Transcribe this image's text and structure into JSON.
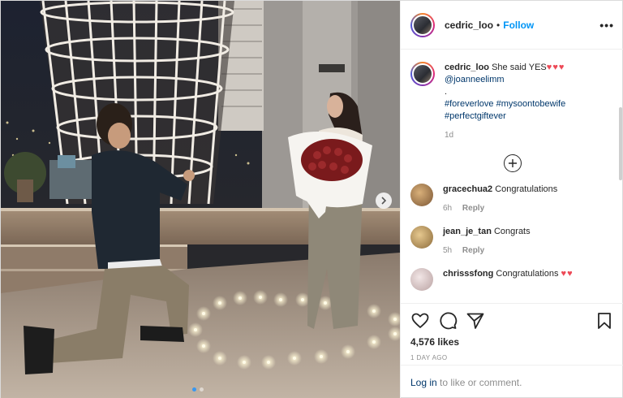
{
  "header": {
    "username": "cedric_loo",
    "separator": "•",
    "follow_label": "Follow",
    "more_label": "•••"
  },
  "caption": {
    "username": "cedric_loo",
    "text": "She said YES",
    "hearts": "♥♥♥",
    "mention": "@joanneelimm",
    "dot_line": ".",
    "hashtags_line1": "#foreverlove #mysoontobewife",
    "hashtags_line2": "#perfectgiftever",
    "time": "1d"
  },
  "load_more_icon": "plus-circle-icon",
  "comments": [
    {
      "username": "gracechua2",
      "text": "Congratulations",
      "hearts": "",
      "time": "6h",
      "reply": "Reply"
    },
    {
      "username": "jean_je_tan",
      "text": "Congrats",
      "hearts": "",
      "time": "5h",
      "reply": "Reply"
    },
    {
      "username": "chrisssfong",
      "text": "Congratulations",
      "hearts": "♥♥",
      "time": "",
      "reply": ""
    }
  ],
  "actions": {
    "likes": "4,576 likes",
    "date": "1 DAY AGO",
    "icons": [
      "heart-icon",
      "comment-icon",
      "share-icon",
      "bookmark-icon"
    ]
  },
  "login": {
    "link": "Log in",
    "rest": " to like or comment."
  },
  "colors": {
    "accent": "#0095f6",
    "heart": "#ed4956",
    "link": "#00376b",
    "muted": "#8e8e8e"
  }
}
